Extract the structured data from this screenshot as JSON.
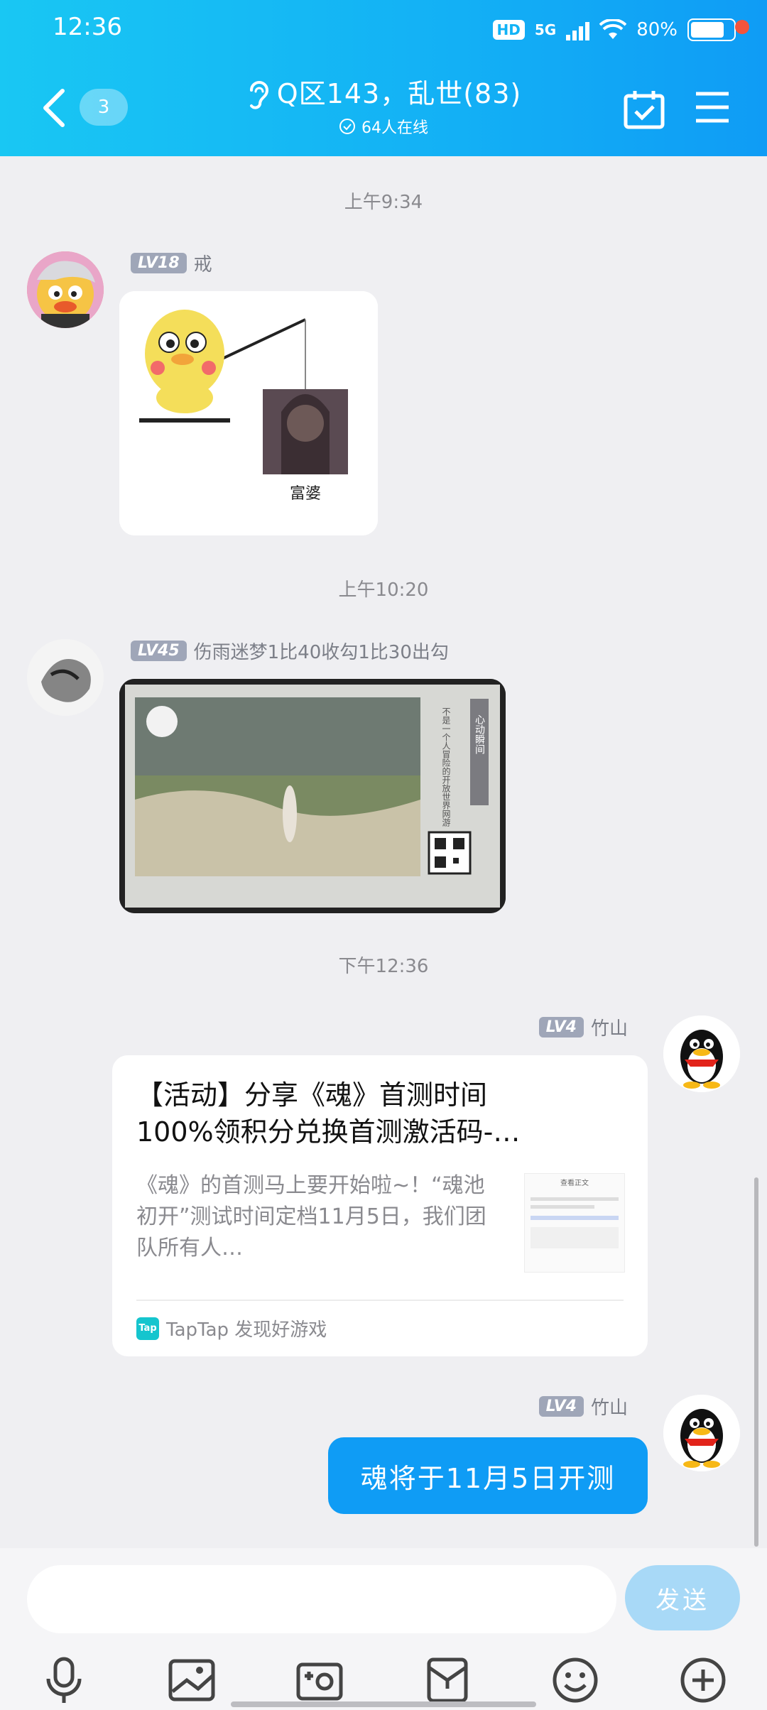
{
  "status_bar": {
    "time": "12:36",
    "hd": "HD",
    "network": "5G",
    "battery": "80%",
    "battery_level": 0.8
  },
  "header": {
    "back_count": "3",
    "title": "Q区143，乱世(83)",
    "subtitle": "64人在线"
  },
  "messages": [
    {
      "timestamp": "上午9:34",
      "level": "LV18",
      "name": "戒",
      "image_caption": "富婆"
    },
    {
      "timestamp": "上午10:20",
      "level": "LV45",
      "name": "伤雨迷梦1比40收勾1比30出勾",
      "image_vertical_text": "不是一个人冒险的开放世界网游",
      "image_tag": "心动瞬间"
    },
    {
      "timestamp": "下午12:36",
      "level": "LV4",
      "name": "竹山",
      "card": {
        "title": "【活动】分享《魂》首测时间100%领积分兑换首测激活码-…",
        "description": "《魂》的首测马上要开始啦~！“魂池初开”测试时间定档11月5日，我们团队所有人…",
        "source_logo": "Tap",
        "source": "TapTap 发现好游戏",
        "thumb_header": "查看正文"
      }
    },
    {
      "level": "LV4",
      "name": "竹山",
      "text": "魂将于11月5日开测"
    }
  ],
  "input": {
    "placeholder": "",
    "send_label": "发送"
  },
  "toolbar": [
    "mic-icon",
    "image-icon",
    "camera-icon",
    "red-packet-icon",
    "emoji-icon",
    "plus-icon"
  ],
  "colors": {
    "header": "#13b0f5",
    "bubble": "#0f9cf5",
    "badge": "#9fa6b8"
  }
}
